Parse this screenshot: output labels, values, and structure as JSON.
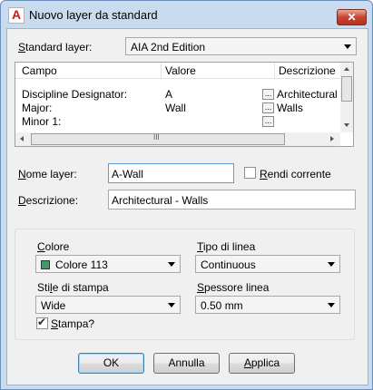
{
  "window": {
    "title": "Nuovo layer da standard",
    "close_label": "✕",
    "app_icon_letter": "A"
  },
  "standard": {
    "label": "Standard layer:",
    "label_key": "S",
    "label_rest": "tandard layer:",
    "value": "AIA 2nd Edition"
  },
  "grid": {
    "columns": [
      "Campo",
      "Valore",
      "Descrizione"
    ],
    "rows": [
      {
        "field": "Discipline Designator:",
        "value": "A",
        "button": "...",
        "description": "Architectural"
      },
      {
        "field": "Major:",
        "value": "Wall",
        "button": "...",
        "description": "Walls"
      },
      {
        "field": "Minor 1:",
        "value": "",
        "button": "...",
        "description": ""
      }
    ],
    "hscroll_grip": "III"
  },
  "layer_name": {
    "label_key": "N",
    "label_rest": "ome layer:",
    "value": "A-Wall"
  },
  "make_current": {
    "label_key": "R",
    "label_rest": "endi corrente",
    "checked": false
  },
  "description": {
    "label_key": "D",
    "label_rest": "escrizione:",
    "value": "Architectural - Walls"
  },
  "properties": {
    "color_label_key": "C",
    "color_label_rest": "olore",
    "color_value": "Colore 113",
    "color_swatch": "#3f9b6b",
    "linetype_label_key": "T",
    "linetype_label_rest": "ipo di linea",
    "linetype_value": "Continuous",
    "plotstyle_label_pre": "Sti",
    "plotstyle_label_key": "l",
    "plotstyle_label_rest": "e di stampa",
    "plotstyle_value": "Wide",
    "lineweight_label_key": "S",
    "lineweight_label_rest": "pessore linea",
    "lineweight_value": "0.50 mm",
    "plot_label_key": "S",
    "plot_label_rest": "tampa?",
    "plot_checked": true
  },
  "buttons": {
    "ok": "OK",
    "cancel": "Annulla",
    "apply_key": "A",
    "apply_rest": "pplica"
  }
}
